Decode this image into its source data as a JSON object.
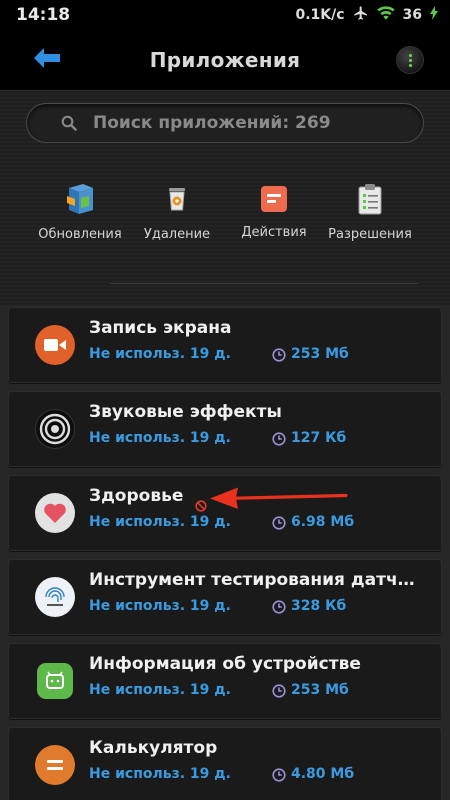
{
  "status_bar": {
    "time": "14:18",
    "speed": "0.1K/c",
    "battery": "36"
  },
  "header": {
    "title": "Приложения",
    "back_icon": "arrow-left-icon",
    "menu_icon": "more-vert-icon"
  },
  "search": {
    "placeholder": "Поиск приложений: 269"
  },
  "actions": [
    {
      "label": "Обновления",
      "icon": "update-box-icon"
    },
    {
      "label": "Удаление",
      "icon": "trash-can-icon"
    },
    {
      "label": "Действия",
      "icon": "actions-list-icon"
    },
    {
      "label": "Разрешения",
      "icon": "clipboard-icon"
    }
  ],
  "apps": [
    {
      "name": "Запись экрана",
      "usage": "Не использ. 19 д.",
      "size": "253 Мб",
      "icon": "screen-record-icon",
      "color": "#e0622a"
    },
    {
      "name": "Звуковые эффекты",
      "usage": "Не использ. 19 д.",
      "size": "127 Кб",
      "icon": "sound-effects-icon",
      "color": "#111111"
    },
    {
      "name": "Здоровье",
      "usage": "Не использ. 19 д.",
      "size": "6.98 Мб",
      "icon": "health-heart-icon",
      "color": "#e2e2e2",
      "blocked": true
    },
    {
      "name": "Инструмент тестирования датч…",
      "usage": "Не использ. 19 д.",
      "size": "328 Кб",
      "icon": "fingerprint-icon",
      "color": "#e9eef3"
    },
    {
      "name": "Информация об устройстве",
      "usage": "Не использ. 19 д.",
      "size": "253 Мб",
      "icon": "android-icon",
      "color": "#5fb84a"
    },
    {
      "name": "Калькулятор",
      "usage": "Не использ. 19 д.",
      "size": "4.80 Мб",
      "icon": "calculator-icon",
      "color": "#e07b2e"
    }
  ],
  "colors": {
    "accent_blue": "#3a9be0",
    "arrow_red": "#e8321e"
  }
}
